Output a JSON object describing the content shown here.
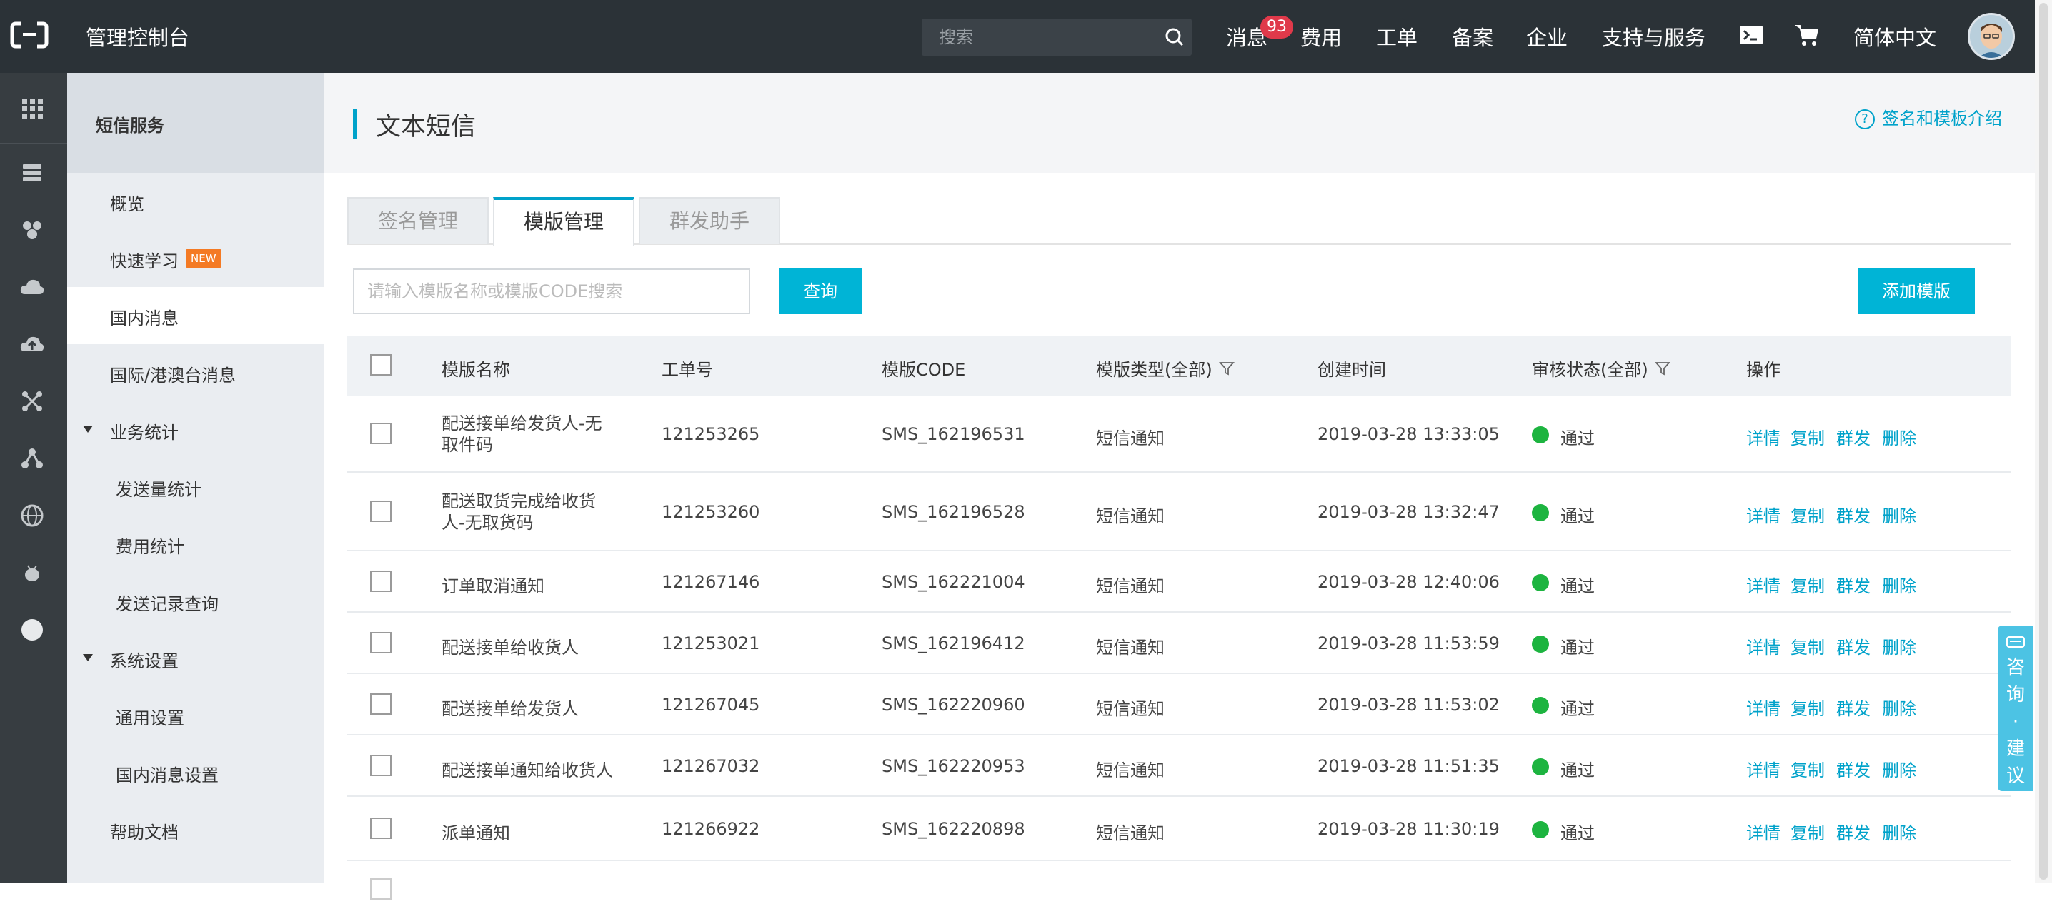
{
  "topbar": {
    "console_title": "管理控制台",
    "search_placeholder": "搜索",
    "nav": [
      "消息",
      "费用",
      "工单",
      "备案",
      "企业",
      "支持与服务",
      "简体中文"
    ],
    "message_badge": "93"
  },
  "sidebar": {
    "section_title": "短信服务",
    "new_badge": "NEW",
    "items": [
      "概览",
      "快速学习",
      "国内消息",
      "国际/港澳台消息",
      "业务统计",
      "发送量统计",
      "费用统计",
      "发送记录查询",
      "系统设置",
      "通用设置",
      "国内消息设置",
      "帮助文档"
    ]
  },
  "page": {
    "title": "文本短信",
    "help_link": "签名和模板介绍"
  },
  "tabs": [
    "签名管理",
    "模版管理",
    "群发助手"
  ],
  "toolbar": {
    "search_placeholder": "请输入模版名称或模版CODE搜索",
    "query_label": "查询",
    "add_label": "添加模版"
  },
  "table": {
    "headers": [
      "模版名称",
      "工单号",
      "模版CODE",
      "模版类型(全部)",
      "创建时间",
      "审核状态(全部)",
      "操作"
    ],
    "actions": [
      "详情",
      "复制",
      "群发",
      "删除"
    ],
    "rows": [
      {
        "name": "配送接单给发货人-无取件码",
        "ticket": "121253265",
        "code": "SMS_162196531",
        "type": "短信通知",
        "created": "2019-03-28 13:33:05",
        "status": "通过"
      },
      {
        "name": "配送取货完成给收货人-无取货码",
        "ticket": "121253260",
        "code": "SMS_162196528",
        "type": "短信通知",
        "created": "2019-03-28 13:32:47",
        "status": "通过"
      },
      {
        "name": "订单取消通知",
        "ticket": "121267146",
        "code": "SMS_162221004",
        "type": "短信通知",
        "created": "2019-03-28 12:40:06",
        "status": "通过"
      },
      {
        "name": "配送接单给收货人",
        "ticket": "121253021",
        "code": "SMS_162196412",
        "type": "短信通知",
        "created": "2019-03-28 11:53:59",
        "status": "通过"
      },
      {
        "name": "配送接单给发货人",
        "ticket": "121267045",
        "code": "SMS_162220960",
        "type": "短信通知",
        "created": "2019-03-28 11:53:02",
        "status": "通过"
      },
      {
        "name": "配送接单通知给收货人",
        "ticket": "121267032",
        "code": "SMS_162220953",
        "type": "短信通知",
        "created": "2019-03-28 11:51:35",
        "status": "通过"
      },
      {
        "name": "派单通知",
        "ticket": "121266922",
        "code": "SMS_162220898",
        "type": "短信通知",
        "created": "2019-03-28 11:30:19",
        "status": "通过"
      }
    ]
  },
  "float_tab": [
    "咨",
    "询",
    "·",
    "建",
    "议"
  ],
  "colors": {
    "accent": "#00a2ca",
    "button": "#00b4d6",
    "status_ok": "#1db440",
    "badge": "#e0394a",
    "new_badge": "#f47a24"
  }
}
